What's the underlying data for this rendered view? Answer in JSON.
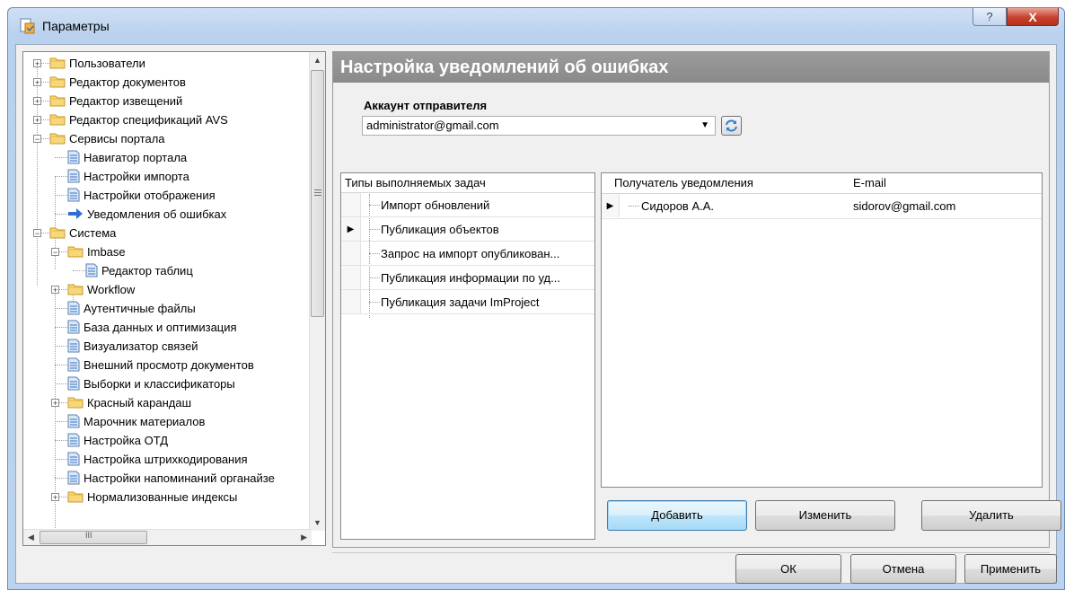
{
  "window": {
    "title": "Параметры",
    "help_glyph": "?",
    "close_glyph": "X"
  },
  "tree": {
    "items": [
      {
        "label": "Пользователи"
      },
      {
        "label": "Редактор документов"
      },
      {
        "label": "Редактор извещений"
      },
      {
        "label": "Редактор спецификаций AVS"
      },
      {
        "label": "Сервисы портала"
      },
      {
        "label": "Навигатор портала"
      },
      {
        "label": "Настройки импорта"
      },
      {
        "label": "Настройки отображения"
      },
      {
        "label": "Уведомления об ошибках"
      },
      {
        "label": "Система"
      },
      {
        "label": "Imbase"
      },
      {
        "label": "Редактор таблиц"
      },
      {
        "label": "Workflow"
      },
      {
        "label": "Аутентичные файлы"
      },
      {
        "label": "База данных и оптимизация"
      },
      {
        "label": "Визуализатор связей"
      },
      {
        "label": "Внешний просмотр документов"
      },
      {
        "label": "Выборки и классификаторы"
      },
      {
        "label": "Красный карандаш"
      },
      {
        "label": "Марочник материалов"
      },
      {
        "label": "Настройка ОТД"
      },
      {
        "label": "Настройка штрихкодирования"
      },
      {
        "label": "Настройки напоминаний органайзе"
      },
      {
        "label": "Нормализованные индексы"
      }
    ],
    "hscroll_glyph": "III"
  },
  "panel": {
    "header": "Настройка уведомлений об ошибках",
    "sender_label": "Аккаунт отправителя",
    "sender_value": "administrator@gmail.com"
  },
  "tasks": {
    "header": "Типы выполняемых задач",
    "rows": [
      "Импорт обновлений",
      "Публикация объектов",
      "Запрос на импорт опубликован...",
      "Публикация информации по уд...",
      "Публикация задачи ImProject"
    ]
  },
  "recipients": {
    "col_name": "Получатель уведомления",
    "col_email": "E-mail",
    "rows": [
      {
        "name": "Сидоров А.А.",
        "email": "sidorov@gmail.com"
      }
    ]
  },
  "buttons": {
    "add": "Добавить",
    "edit": "Изменить",
    "delete": "Удалить",
    "ok": "ОК",
    "cancel": "Отмена",
    "apply": "Применить"
  }
}
